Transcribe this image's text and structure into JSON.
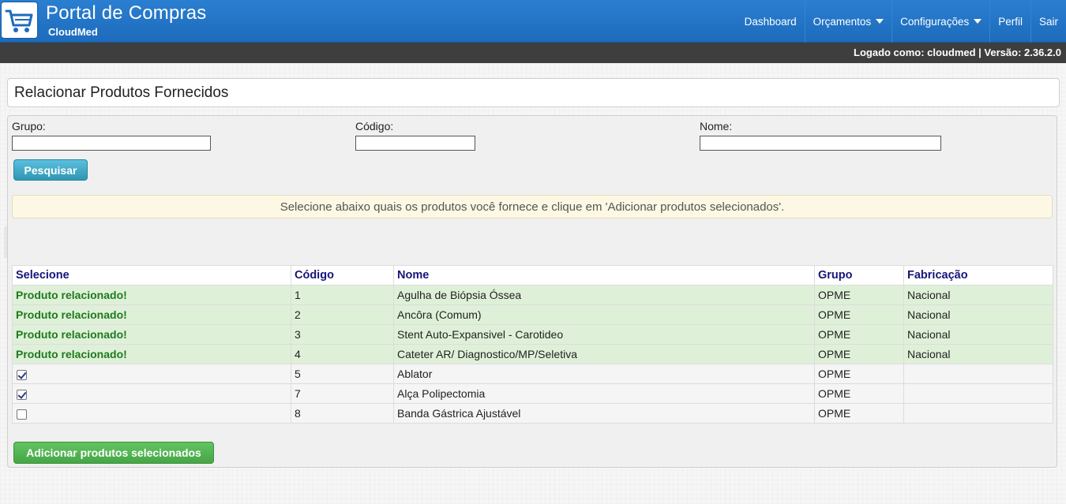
{
  "header": {
    "app_title": "Portal de Compras",
    "company": "CloudMed",
    "logo_icon": "shopping-cart-icon",
    "nav": [
      {
        "label": "Dashboard",
        "dropdown": false
      },
      {
        "label": "Orçamentos",
        "dropdown": true
      },
      {
        "label": "Configurações",
        "dropdown": true
      },
      {
        "label": "Perfil",
        "dropdown": false
      },
      {
        "label": "Sair",
        "dropdown": false
      }
    ]
  },
  "status": {
    "text": "Logado como: cloudmed | Versão: 2.36.2.0"
  },
  "page": {
    "title": "Relacionar Produtos Fornecidos"
  },
  "filters": {
    "grupo_label": "Grupo:",
    "grupo_value": "",
    "codigo_label": "Código:",
    "codigo_value": "",
    "nome_label": "Nome:",
    "nome_value": "",
    "search_button": "Pesquisar"
  },
  "info": {
    "message": "Selecione abaixo quais os produtos você fornece e clique em 'Adicionar produtos selecionados'."
  },
  "table": {
    "headers": {
      "selecione": "Selecione",
      "codigo": "Código",
      "nome": "Nome",
      "grupo": "Grupo",
      "fabricacao": "Fabricação"
    },
    "rows": [
      {
        "related": true,
        "status": "Produto relacionado!",
        "checked": false,
        "codigo": "1",
        "nome": "Agulha de Biópsia Óssea",
        "grupo": "OPME",
        "fabricacao": "Nacional"
      },
      {
        "related": true,
        "status": "Produto relacionado!",
        "checked": false,
        "codigo": "2",
        "nome": "Ancôra (Comum)",
        "grupo": "OPME",
        "fabricacao": "Nacional"
      },
      {
        "related": true,
        "status": "Produto relacionado!",
        "checked": false,
        "codigo": "3",
        "nome": "Stent Auto-Expansivel - Carotideo",
        "grupo": "OPME",
        "fabricacao": "Nacional"
      },
      {
        "related": true,
        "status": "Produto relacionado!",
        "checked": false,
        "codigo": "4",
        "nome": "Cateter AR/ Diagnostico/MP/Seletiva",
        "grupo": "OPME",
        "fabricacao": "Nacional"
      },
      {
        "related": false,
        "status": "",
        "checked": true,
        "codigo": "5",
        "nome": "Ablator",
        "grupo": "OPME",
        "fabricacao": ""
      },
      {
        "related": false,
        "status": "",
        "checked": true,
        "codigo": "7",
        "nome": "Alça Polipectomia",
        "grupo": "OPME",
        "fabricacao": ""
      },
      {
        "related": false,
        "status": "",
        "checked": false,
        "codigo": "8",
        "nome": "Banda Gástrica Ajustável",
        "grupo": "OPME",
        "fabricacao": ""
      }
    ]
  },
  "actions": {
    "add_button": "Adicionar produtos selecionados"
  }
}
